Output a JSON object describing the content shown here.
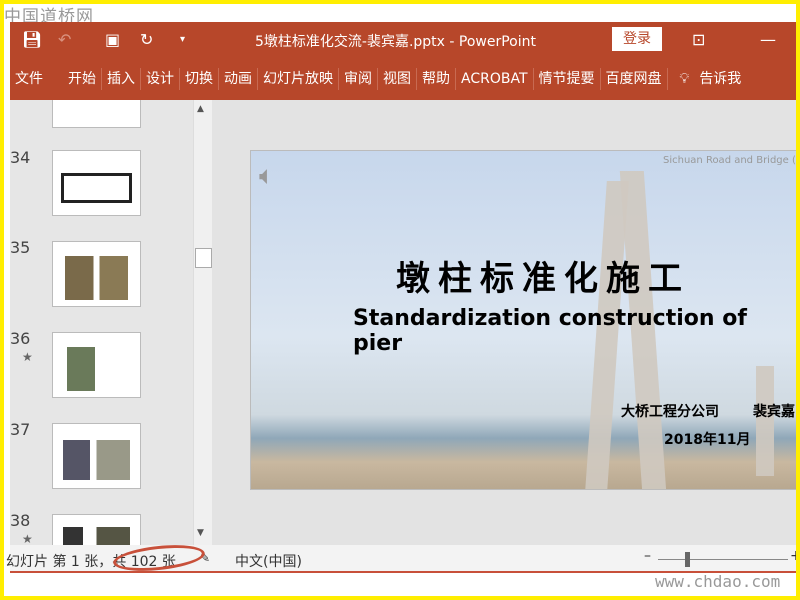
{
  "watermark_top": "中国道桥网",
  "watermark_bottom": "www.chdao.com",
  "window": {
    "title": "5墩柱标准化交流-裴宾嘉.pptx  -  PowerPoint",
    "login": "登录",
    "accent": "#b7472a"
  },
  "ribbon": {
    "tabs": [
      "文件",
      "开始",
      "插入",
      "设计",
      "切换",
      "动画",
      "幻灯片放映",
      "审阅",
      "视图",
      "帮助",
      "ACROBAT",
      "情节提要",
      "百度网盘"
    ],
    "tell_me": "告诉我"
  },
  "thumbnails": [
    {
      "n": "34",
      "star": false
    },
    {
      "n": "35",
      "star": false
    },
    {
      "n": "36",
      "star": true
    },
    {
      "n": "37",
      "star": false
    },
    {
      "n": "38",
      "star": true
    }
  ],
  "slide": {
    "title_cn": "墩柱标准化施工",
    "title_en": "Standardization construction of pier",
    "company": "大桥工程分公司",
    "author": "裴宾嘉",
    "date": "2018年11月",
    "logo_text": "Sichuan Road and Bridge (Group"
  },
  "status": {
    "slide_info": "幻灯片 第 1 张，共 102 张",
    "language": "中文(中国)"
  }
}
